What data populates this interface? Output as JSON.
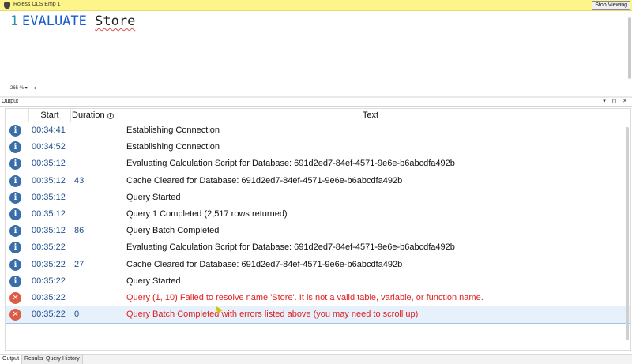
{
  "banner": {
    "title": "Roless OLS Emp 1",
    "stop_label": "Stop Viewing"
  },
  "editor": {
    "line_number": "1",
    "keyword": "EVALUATE",
    "identifier": "Store",
    "zoom": "265 %"
  },
  "output": {
    "panel_label": "Output",
    "header_buttons": "▾ ⊓ ✕",
    "columns": {
      "start": "Start",
      "duration": "Duration",
      "text": "Text"
    },
    "rows": [
      {
        "type": "info",
        "start": "00:34:41",
        "duration": "",
        "text": "Establishing Connection"
      },
      {
        "type": "info",
        "start": "00:34:52",
        "duration": "",
        "text": "Establishing Connection"
      },
      {
        "type": "info",
        "start": "00:35:12",
        "duration": "",
        "text": "Evaluating Calculation Script for Database: 691d2ed7-84ef-4571-9e6e-b6abcdfa492b"
      },
      {
        "type": "info",
        "start": "00:35:12",
        "duration": "43",
        "text": "Cache Cleared for Database: 691d2ed7-84ef-4571-9e6e-b6abcdfa492b"
      },
      {
        "type": "info",
        "start": "00:35:12",
        "duration": "",
        "text": "Query Started"
      },
      {
        "type": "info",
        "start": "00:35:12",
        "duration": "",
        "text": "Query 1 Completed (2,517 rows returned)"
      },
      {
        "type": "info",
        "start": "00:35:12",
        "duration": "86",
        "text": "Query Batch Completed"
      },
      {
        "type": "info",
        "start": "00:35:22",
        "duration": "",
        "text": "Evaluating Calculation Script for Database: 691d2ed7-84ef-4571-9e6e-b6abcdfa492b"
      },
      {
        "type": "info",
        "start": "00:35:22",
        "duration": "27",
        "text": "Cache Cleared for Database: 691d2ed7-84ef-4571-9e6e-b6abcdfa492b"
      },
      {
        "type": "info",
        "start": "00:35:22",
        "duration": "",
        "text": "Query Started"
      },
      {
        "type": "error",
        "start": "00:35:22",
        "duration": "",
        "text": "Query (1, 10) Failed to resolve name 'Store'. It is not a valid table, variable, or function name."
      },
      {
        "type": "error",
        "start": "00:35:22",
        "duration": "0",
        "text": "Query Batch Completed with errors listed above (you may need to scroll up)",
        "selected": true
      }
    ]
  },
  "tabs": [
    {
      "label": "Output",
      "active": true
    },
    {
      "label": "Results",
      "active": false
    },
    {
      "label": "Query History",
      "active": false
    }
  ],
  "colors": {
    "banner_bg": "#fdf58a",
    "keyword": "#1a5ccf",
    "info_icon": "#3a6ea8",
    "error_icon": "#de5b44",
    "error_text": "#e02020",
    "selected_row": "#e6f1fb"
  },
  "icons": {
    "info": "info-circle-icon",
    "error": "error-x-icon"
  }
}
